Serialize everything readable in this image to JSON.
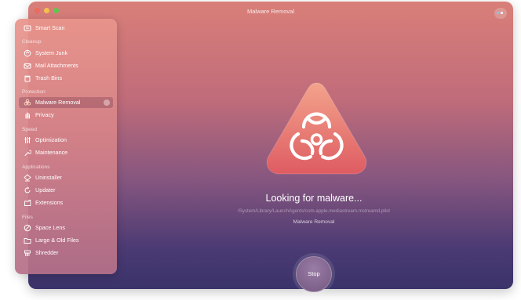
{
  "window": {
    "title": "Malware Removal"
  },
  "sidebar": {
    "top": {
      "label": "Smart Scan",
      "icon": "smart-scan-icon"
    },
    "sections": [
      {
        "title": "Cleanup",
        "items": [
          {
            "label": "System Junk",
            "icon": "system-junk-icon"
          },
          {
            "label": "Mail Attachments",
            "icon": "mail-icon"
          },
          {
            "label": "Trash Bins",
            "icon": "trash-icon"
          }
        ]
      },
      {
        "title": "Protection",
        "items": [
          {
            "label": "Malware Removal",
            "icon": "biohazard-icon",
            "active": true
          },
          {
            "label": "Privacy",
            "icon": "hand-icon"
          }
        ]
      },
      {
        "title": "Speed",
        "items": [
          {
            "label": "Optimization",
            "icon": "sliders-icon"
          },
          {
            "label": "Maintenance",
            "icon": "wrench-icon"
          }
        ]
      },
      {
        "title": "Applications",
        "items": [
          {
            "label": "Uninstaller",
            "icon": "uninstaller-icon"
          },
          {
            "label": "Updater",
            "icon": "updater-icon"
          },
          {
            "label": "Extensions",
            "icon": "extensions-icon"
          }
        ]
      },
      {
        "title": "Files",
        "items": [
          {
            "label": "Space Lens",
            "icon": "space-lens-icon"
          },
          {
            "label": "Large & Old Files",
            "icon": "folder-icon"
          },
          {
            "label": "Shredder",
            "icon": "shredder-icon"
          }
        ]
      }
    ]
  },
  "main": {
    "status": "Looking for malware...",
    "path": "/System/Library/LaunchAgents/com.apple.mediastream.mstreamd.plist",
    "module": "Malware Removal",
    "stop_label": "Stop"
  },
  "colors": {
    "accent_red": "#ec6a5e",
    "accent_yellow": "#f4bf4f",
    "accent_green": "#61c554",
    "hero_gradient_top": "#f09a86",
    "hero_gradient_bottom": "#e05f63"
  }
}
